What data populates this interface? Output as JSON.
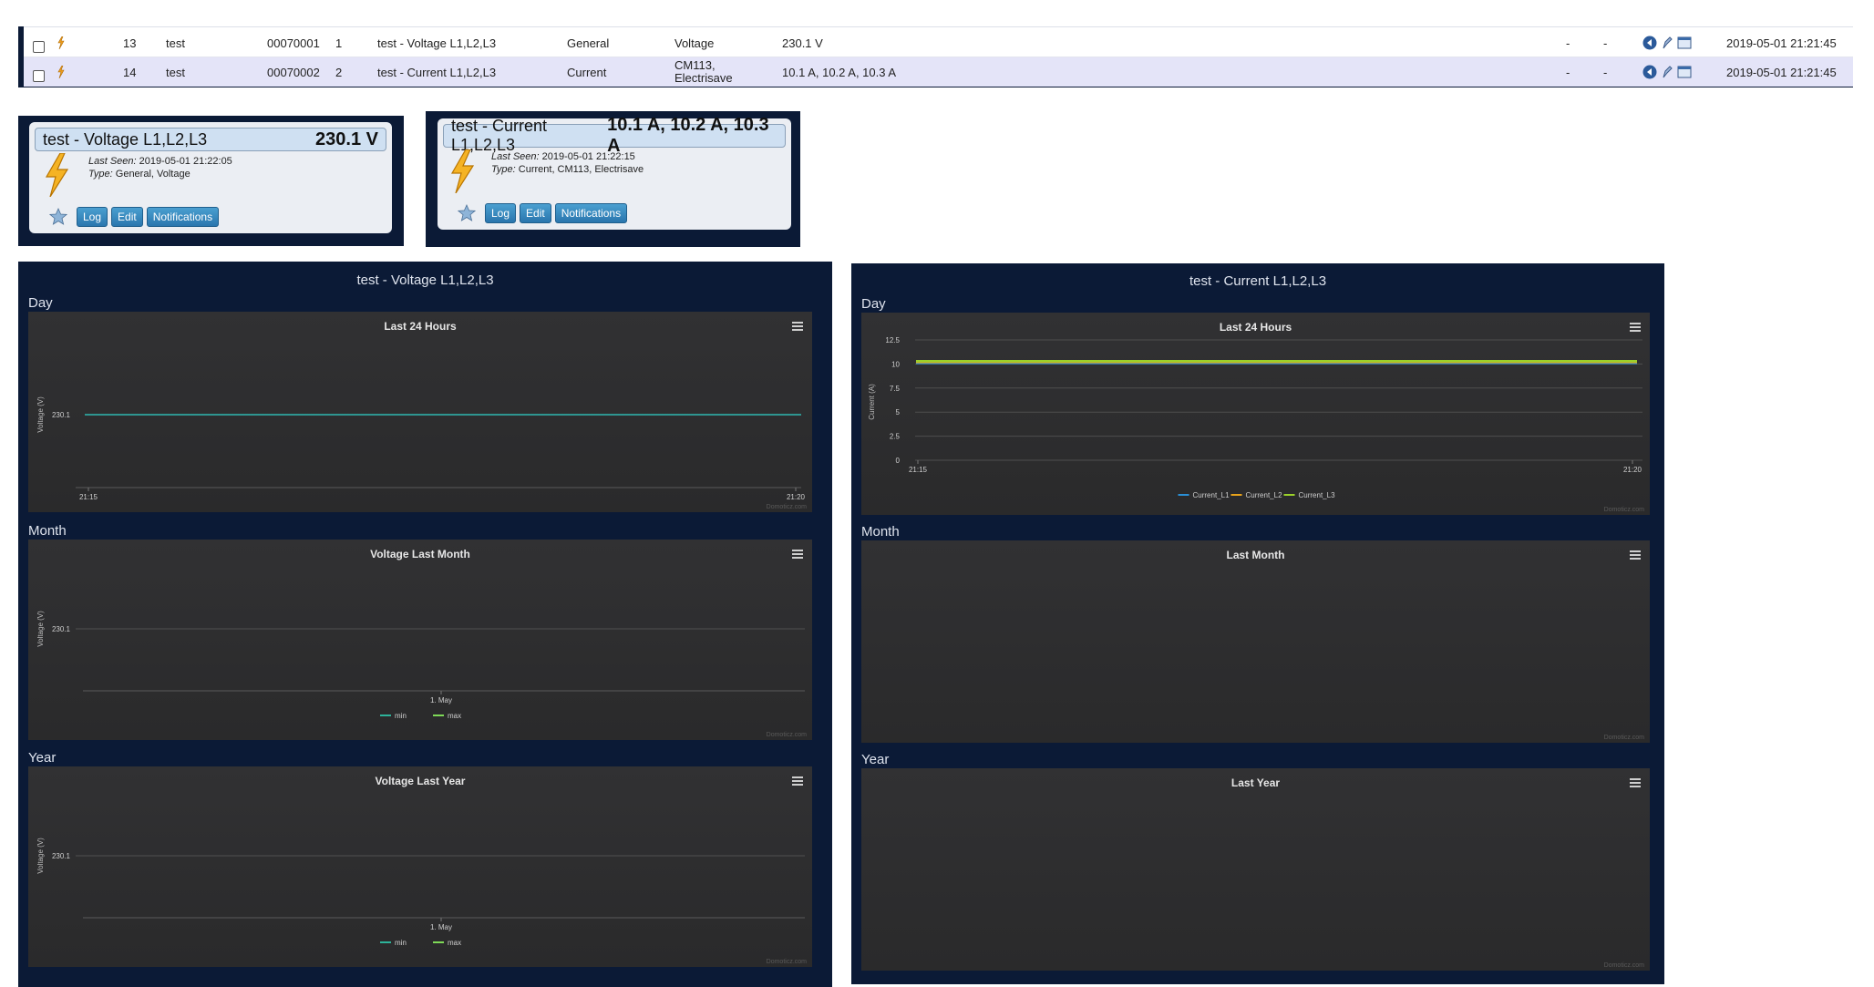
{
  "device_table": {
    "rows": [
      {
        "idx": "13",
        "hardware": "test",
        "id": "00070001",
        "unit": "1",
        "name": "test - Voltage L1,L2,L3",
        "type": "General",
        "subtype": "Voltage",
        "data": "230.1 V",
        "sig": "-",
        "bat": "-",
        "last_seen": "2019-05-01 21:21:45"
      },
      {
        "idx": "14",
        "hardware": "test",
        "id": "00070002",
        "unit": "2",
        "name": "test - Current L1,L2,L3",
        "type": "Current",
        "subtype": "CM113, Electrisave",
        "data": "10.1 A, 10.2 A, 10.3 A",
        "sig": "-",
        "bat": "-",
        "last_seen": "2019-05-01 21:21:45"
      }
    ],
    "icons": [
      "bolt-icon",
      "back-arrow-icon",
      "edit-pencil-icon",
      "window-icon"
    ]
  },
  "widgets": [
    {
      "name": "test - Voltage L1,L2,L3",
      "value": "230.1 V",
      "last_seen_label": "Last Seen:",
      "last_seen": "2019-05-01 21:22:05",
      "type_label": "Type:",
      "type": "General, Voltage",
      "buttons": [
        "Log",
        "Edit",
        "Notifications"
      ]
    },
    {
      "name": "test - Current L1,L2,L3",
      "value": "10.1 A, 10.2 A, 10.3 A",
      "last_seen_label": "Last Seen:",
      "last_seen": "2019-05-01 21:22:15",
      "type_label": "Type:",
      "type": "Current, CM113, Electrisave",
      "buttons": [
        "Log",
        "Edit",
        "Notifications"
      ]
    }
  ],
  "panels": [
    {
      "title": "test - Voltage L1,L2,L3",
      "sections": [
        "Day",
        "Month",
        "Year"
      ]
    },
    {
      "title": "test - Current L1,L2,L3",
      "sections": [
        "Day",
        "Month",
        "Year"
      ]
    }
  ],
  "credits": "Domoticz.com",
  "colors": {
    "navy": "#0b1a36",
    "chart_bg": "#2d2d2f",
    "current_l1": "#2a8fd6",
    "current_l2": "#e8a21a",
    "current_l3": "#9bd12a",
    "voltage_line": "#2fb8b0",
    "min": "#2db39a",
    "max": "#7ed957"
  },
  "chart_data": [
    {
      "type": "line",
      "title": "Last 24 Hours",
      "ylabel": "Voltage (V)",
      "x_ticks": [
        "21:15",
        "21:20"
      ],
      "y_ticks": [
        "230.1"
      ],
      "series": [
        {
          "x": [
            "21:15",
            "21:20"
          ],
          "values": [
            230.1,
            230.1
          ]
        }
      ]
    },
    {
      "type": "line",
      "title": "Voltage Last Month",
      "ylabel": "Voltage (V)",
      "x_ticks": [
        "1. May"
      ],
      "y_ticks": [
        "230.1"
      ],
      "series": [
        {
          "name": "min",
          "values": []
        },
        {
          "name": "max",
          "values": []
        }
      ]
    },
    {
      "type": "line",
      "title": "Voltage Last Year",
      "ylabel": "Voltage (V)",
      "x_ticks": [
        "1. May"
      ],
      "y_ticks": [
        "230.1"
      ],
      "series": [
        {
          "name": "min",
          "values": []
        },
        {
          "name": "max",
          "values": []
        }
      ]
    },
    {
      "type": "line",
      "title": "Last 24 Hours",
      "ylabel": "Current (A)",
      "x_ticks": [
        "21:15",
        "21:20"
      ],
      "y_ticks": [
        "0",
        "2.5",
        "5",
        "7.5",
        "10",
        "12.5"
      ],
      "ylim": [
        0,
        12.5
      ],
      "series": [
        {
          "name": "Current_L1",
          "x": [
            "21:15",
            "21:20"
          ],
          "values": [
            10.1,
            10.1
          ]
        },
        {
          "name": "Current_L2",
          "x": [
            "21:15",
            "21:20"
          ],
          "values": [
            10.2,
            10.2
          ]
        },
        {
          "name": "Current_L3",
          "x": [
            "21:15",
            "21:20"
          ],
          "values": [
            10.3,
            10.3
          ]
        }
      ]
    },
    {
      "type": "line",
      "title": "Last Month",
      "series": []
    },
    {
      "type": "line",
      "title": "Last Year",
      "series": []
    }
  ]
}
